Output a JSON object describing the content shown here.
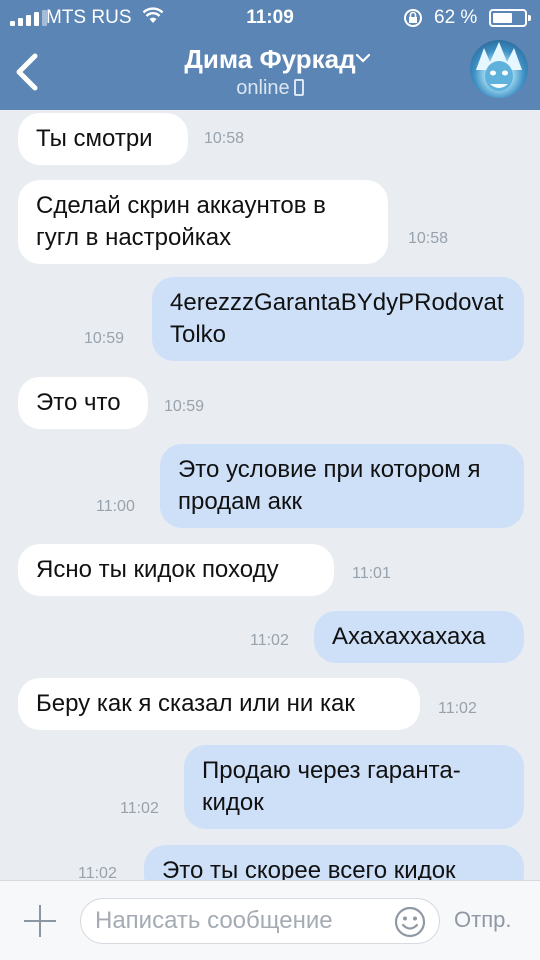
{
  "status_bar": {
    "carrier": "MTS RUS",
    "time": "11:09",
    "battery_percent": "62 %",
    "battery_level": 0.62
  },
  "header": {
    "contact_name": "Дима Фуркад",
    "presence": "online"
  },
  "messages": [
    {
      "direction": "in",
      "text": "Ты смотри",
      "time": "10:58"
    },
    {
      "direction": "in",
      "text": "Сделай скрин аккаунтов в гугл в настройках",
      "time": "10:58"
    },
    {
      "direction": "out",
      "text": "4erezzzGarantaBYdyPRodovatTolko",
      "time": "10:59"
    },
    {
      "direction": "in",
      "text": "Это что",
      "time": "10:59"
    },
    {
      "direction": "out",
      "text": "Это условие при котором я продам акк",
      "time": "11:00"
    },
    {
      "direction": "in",
      "text": "Ясно ты кидок походу",
      "time": "11:01"
    },
    {
      "direction": "out",
      "text": "Ахахаххахаха",
      "time": "11:02"
    },
    {
      "direction": "in",
      "text": "Беру как я сказал или ни как",
      "time": "11:02"
    },
    {
      "direction": "out",
      "text": "Продаю через гаранта-кидок",
      "time": "11:02"
    },
    {
      "direction": "out",
      "text": "Это ты скорее всего кидок",
      "time": "11:02"
    }
  ],
  "composer": {
    "placeholder": "Написать сообщение",
    "send_label": "Отпр."
  },
  "colors": {
    "header": "#5b85b4",
    "chat_background": "#e9ecf0",
    "incoming_bubble": "#ffffff",
    "outgoing_bubble": "#cde0f8",
    "timestamp": "#98a2ad"
  },
  "icons": [
    "signal-icon",
    "wifi-icon",
    "lock-rotation-icon",
    "battery-icon",
    "back-chevron-icon",
    "dropdown-chevron-icon",
    "phone-icon",
    "plus-icon",
    "smiley-icon"
  ]
}
